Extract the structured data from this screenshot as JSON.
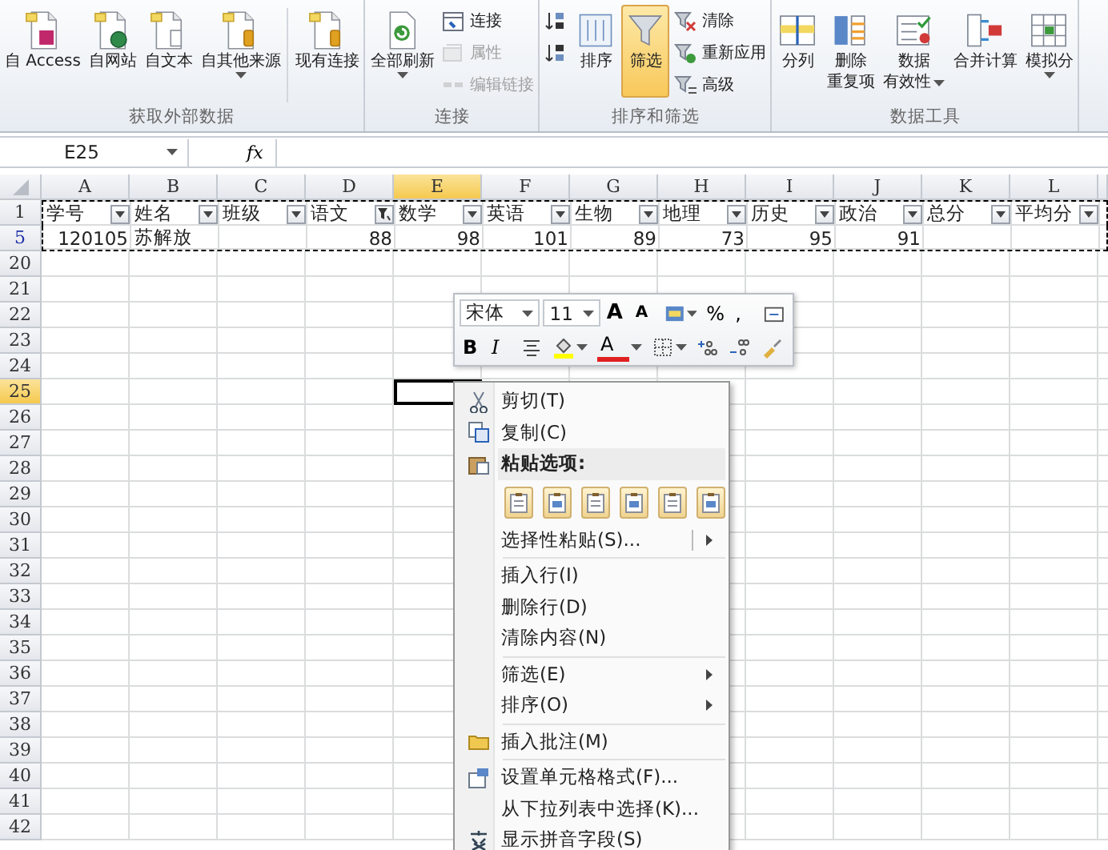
{
  "ribbon": {
    "groups": [
      {
        "label": "获取外部数据",
        "controls": [
          {
            "kind": "large",
            "lines": [
              "自 Access"
            ],
            "dropdown": false,
            "selected": false,
            "disabled": false
          },
          {
            "kind": "large",
            "lines": [
              "自网站"
            ],
            "dropdown": false,
            "selected": false,
            "disabled": false
          },
          {
            "kind": "large",
            "lines": [
              "自文本"
            ],
            "dropdown": false,
            "selected": false,
            "disabled": false
          },
          {
            "kind": "large",
            "lines": [
              "自其他来源"
            ],
            "dropdown": true,
            "selected": false,
            "disabled": false
          },
          {
            "kind": "separator"
          },
          {
            "kind": "large",
            "lines": [
              "现有连接"
            ],
            "dropdown": false,
            "selected": false,
            "disabled": false
          }
        ]
      },
      {
        "label": "连接",
        "controls": [
          {
            "kind": "large",
            "lines": [
              "全部刷新"
            ],
            "dropdown": true,
            "selected": false,
            "disabled": false
          },
          {
            "kind": "stack",
            "items": [
              {
                "label": "连接",
                "disabled": false
              },
              {
                "label": "属性",
                "disabled": true
              },
              {
                "label": "编辑链接",
                "disabled": true
              }
            ]
          }
        ]
      },
      {
        "label": "排序和筛选",
        "controls": [
          {
            "kind": "stack",
            "items": [
              {
                "disabled": false
              },
              {
                "disabled": false
              }
            ]
          },
          {
            "kind": "large",
            "lines": [
              "排序"
            ],
            "dropdown": false,
            "selected": false,
            "disabled": false
          },
          {
            "kind": "large",
            "lines": [
              "筛选"
            ],
            "dropdown": false,
            "selected": true,
            "disabled": false
          },
          {
            "kind": "stack",
            "items": [
              {
                "label": "清除",
                "disabled": false
              },
              {
                "label": "重新应用",
                "disabled": false
              },
              {
                "label": "高级",
                "disabled": false
              }
            ]
          }
        ]
      },
      {
        "label": "数据工具",
        "controls": [
          {
            "kind": "large",
            "lines": [
              "分列"
            ],
            "dropdown": false,
            "selected": false,
            "disabled": false
          },
          {
            "kind": "large",
            "lines": [
              "删除",
              "重复项"
            ],
            "dropdown": false,
            "selected": false,
            "disabled": false
          },
          {
            "kind": "large",
            "lines": [
              "数据",
              "有效性"
            ],
            "dropdown": true,
            "selected": false,
            "disabled": false
          },
          {
            "kind": "large",
            "lines": [
              "合并计算"
            ],
            "dropdown": false,
            "selected": false,
            "disabled": false
          },
          {
            "kind": "large",
            "lines": [
              "模拟分"
            ],
            "dropdown": true,
            "selected": false,
            "disabled": false
          }
        ]
      }
    ]
  },
  "formula_bar": {
    "name_box": "E25",
    "function_label": "fx"
  },
  "sheet": {
    "columns": [
      {
        "label": "A",
        "selected": false
      },
      {
        "label": "B",
        "selected": false
      },
      {
        "label": "C",
        "selected": false
      },
      {
        "label": "D",
        "selected": false
      },
      {
        "label": "E",
        "selected": true
      },
      {
        "label": "F",
        "selected": false
      },
      {
        "label": "G",
        "selected": false
      },
      {
        "label": "H",
        "selected": false
      },
      {
        "label": "I",
        "selected": false
      },
      {
        "label": "J",
        "selected": false
      },
      {
        "label": "K",
        "selected": false
      },
      {
        "label": "L",
        "selected": false
      }
    ],
    "rows": [
      {
        "number": "1",
        "selected": false,
        "copied": true,
        "filtered": false,
        "cells": [
          {
            "kind": "header",
            "text": "学号",
            "filter_applied": false
          },
          {
            "kind": "header",
            "text": "姓名",
            "filter_applied": false
          },
          {
            "kind": "header",
            "text": "班级",
            "filter_applied": false
          },
          {
            "kind": "header",
            "text": "语文",
            "filter_applied": true
          },
          {
            "kind": "header",
            "text": "数学",
            "filter_applied": false
          },
          {
            "kind": "header",
            "text": "英语",
            "filter_applied": false
          },
          {
            "kind": "header",
            "text": "生物",
            "filter_applied": false
          },
          {
            "kind": "header",
            "text": "地理",
            "filter_applied": false
          },
          {
            "kind": "header",
            "text": "历史",
            "filter_applied": false
          },
          {
            "kind": "header",
            "text": "政治",
            "filter_applied": false
          },
          {
            "kind": "header",
            "text": "总分",
            "filter_applied": false
          },
          {
            "kind": "header",
            "text": "平均分",
            "filter_applied": false
          }
        ]
      },
      {
        "number": "5",
        "selected": false,
        "copied": true,
        "filtered": true,
        "cells": [
          {
            "kind": "number",
            "text": "120105"
          },
          {
            "kind": "text",
            "text": "苏解放"
          },
          {
            "kind": "empty"
          },
          {
            "kind": "number",
            "text": "88"
          },
          {
            "kind": "number",
            "text": "98"
          },
          {
            "kind": "number",
            "text": "101"
          },
          {
            "kind": "number",
            "text": "89"
          },
          {
            "kind": "number",
            "text": "73"
          },
          {
            "kind": "number",
            "text": "95"
          },
          {
            "kind": "number",
            "text": "91"
          },
          {
            "kind": "empty"
          },
          {
            "kind": "empty"
          }
        ]
      },
      {
        "number": "20",
        "selected": false,
        "copied": false,
        "filtered": false,
        "cells": []
      },
      {
        "number": "21",
        "selected": false,
        "copied": false,
        "filtered": false,
        "cells": []
      },
      {
        "number": "22",
        "selected": false,
        "copied": false,
        "filtered": false,
        "cells": []
      },
      {
        "number": "23",
        "selected": false,
        "copied": false,
        "filtered": false,
        "cells": []
      },
      {
        "number": "24",
        "selected": false,
        "copied": false,
        "filtered": false,
        "cells": []
      },
      {
        "number": "25",
        "selected": true,
        "copied": false,
        "filtered": false,
        "cells": []
      },
      {
        "number": "26",
        "selected": false,
        "copied": false,
        "filtered": false,
        "cells": []
      },
      {
        "number": "27",
        "selected": false,
        "copied": false,
        "filtered": false,
        "cells": []
      },
      {
        "number": "28",
        "selected": false,
        "copied": false,
        "filtered": false,
        "cells": []
      },
      {
        "number": "29",
        "selected": false,
        "copied": false,
        "filtered": false,
        "cells": []
      },
      {
        "number": "30",
        "selected": false,
        "copied": false,
        "filtered": false,
        "cells": []
      },
      {
        "number": "31",
        "selected": false,
        "copied": false,
        "filtered": false,
        "cells": []
      },
      {
        "number": "32",
        "selected": false,
        "copied": false,
        "filtered": false,
        "cells": []
      },
      {
        "number": "33",
        "selected": false,
        "copied": false,
        "filtered": false,
        "cells": []
      },
      {
        "number": "34",
        "selected": false,
        "copied": false,
        "filtered": false,
        "cells": []
      },
      {
        "number": "35",
        "selected": false,
        "copied": false,
        "filtered": false,
        "cells": []
      },
      {
        "number": "36",
        "selected": false,
        "copied": false,
        "filtered": false,
        "cells": []
      },
      {
        "number": "37",
        "selected": false,
        "copied": false,
        "filtered": false,
        "cells": []
      },
      {
        "number": "38",
        "selected": false,
        "copied": false,
        "filtered": false,
        "cells": []
      },
      {
        "number": "39",
        "selected": false,
        "copied": false,
        "filtered": false,
        "cells": []
      },
      {
        "number": "40",
        "selected": false,
        "copied": false,
        "filtered": false,
        "cells": []
      },
      {
        "number": "41",
        "selected": false,
        "copied": false,
        "filtered": false,
        "cells": []
      },
      {
        "number": "42",
        "selected": false,
        "copied": false,
        "filtered": false,
        "cells": []
      }
    ]
  },
  "mini_toolbar": {
    "rows": [
      {
        "items": [
          {
            "kind": "select",
            "value": "宋体"
          },
          {
            "kind": "select",
            "value": "11"
          },
          {
            "kind": "text",
            "text": "A",
            "dropdown": false
          },
          {
            "kind": "text",
            "text": "A",
            "dropdown": false
          },
          {
            "kind": "icon",
            "dropdown": true
          },
          {
            "kind": "text",
            "text": "%",
            "dropdown": false
          },
          {
            "kind": "text",
            "text": ",",
            "dropdown": false
          },
          {
            "kind": "icon",
            "dropdown": false
          }
        ]
      },
      {
        "items": [
          {
            "kind": "text",
            "text": "B",
            "dropdown": false
          },
          {
            "kind": "text",
            "text": "I",
            "dropdown": false
          },
          {
            "kind": "icon",
            "dropdown": false
          },
          {
            "kind": "icon",
            "dropdown": true
          },
          {
            "kind": "text",
            "text": "A",
            "dropdown": true
          },
          {
            "kind": "icon",
            "dropdown": true
          },
          {
            "kind": "icon",
            "dropdown": false
          },
          {
            "kind": "icon",
            "dropdown": false
          },
          {
            "kind": "icon",
            "dropdown": false
          }
        ]
      }
    ]
  },
  "context_menu": {
    "items": [
      {
        "kind": "item",
        "label": "剪切(T)",
        "submenu": false
      },
      {
        "kind": "item",
        "label": "复制(C)",
        "submenu": false
      },
      {
        "kind": "heading",
        "label": "粘贴选项:"
      },
      {
        "kind": "paste_row"
      },
      {
        "kind": "item",
        "label": "选择性粘贴(S)...",
        "submenu": true
      },
      {
        "kind": "separator"
      },
      {
        "kind": "item",
        "label": "插入行(I)",
        "submenu": false
      },
      {
        "kind": "item",
        "label": "删除行(D)",
        "submenu": false
      },
      {
        "kind": "item",
        "label": "清除内容(N)",
        "submenu": false
      },
      {
        "kind": "separator"
      },
      {
        "kind": "item",
        "label": "筛选(E)",
        "submenu": true
      },
      {
        "kind": "item",
        "label": "排序(O)",
        "submenu": true
      },
      {
        "kind": "separator"
      },
      {
        "kind": "item",
        "label": "插入批注(M)",
        "submenu": false
      },
      {
        "kind": "separator"
      },
      {
        "kind": "item",
        "label": "设置单元格格式(F)...",
        "submenu": false
      },
      {
        "kind": "item",
        "label": "从下拉列表中选择(K)...",
        "submenu": false
      },
      {
        "kind": "item",
        "label": "显示拼音字段(S)",
        "submenu": false
      }
    ]
  }
}
